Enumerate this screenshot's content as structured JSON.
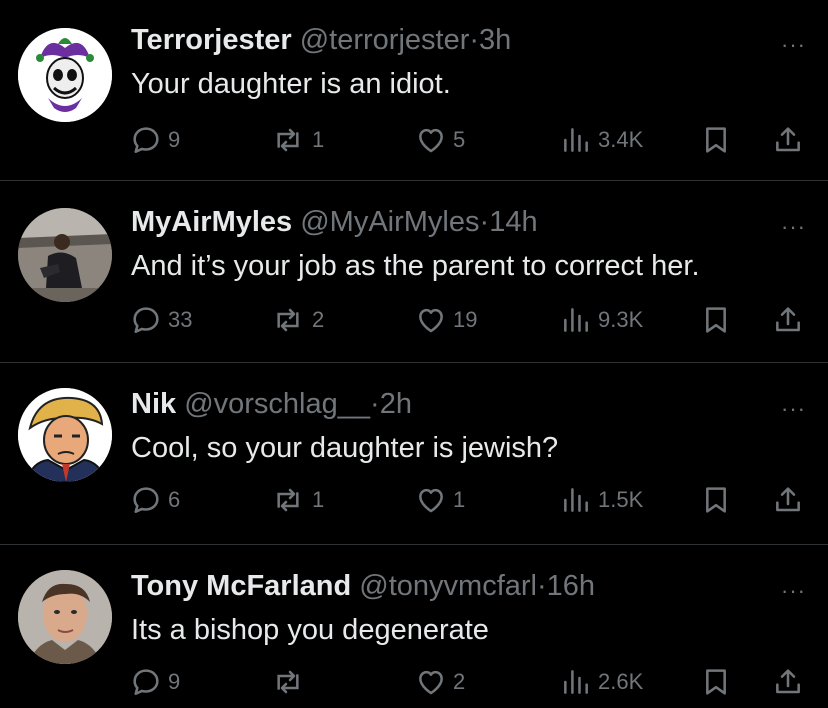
{
  "tweets": [
    {
      "name": "Terrorjester",
      "handle": "@terrorjester",
      "dot": "·",
      "time": "3h",
      "text": "Your daughter is an idiot.",
      "more": "···",
      "replies": "9",
      "reposts": "1",
      "likes": "5",
      "views": "3.4K"
    },
    {
      "name": "MyAirMyles",
      "handle": "@MyAirMyles",
      "dot": "·",
      "time": "14h",
      "text": "And it’s your job as the parent to correct her.",
      "more": "···",
      "replies": "33",
      "reposts": "2",
      "likes": "19",
      "views": "9.3K"
    },
    {
      "name": "Nik",
      "handle": "@vorschlag__",
      "dot": "·",
      "time": "2h",
      "text": "Cool, so your daughter is jewish?",
      "more": "···",
      "replies": "6",
      "reposts": "1",
      "likes": "1",
      "views": "1.5K"
    },
    {
      "name": "Tony McFarland",
      "handle": "@tonyvmcfarl",
      "dot": "·",
      "time": "16h",
      "text": "Its a bishop you degenerate",
      "more": "···",
      "replies": "9",
      "reposts": "",
      "likes": "2",
      "views": "2.6K"
    }
  ],
  "colors": {
    "background": "#000000",
    "text": "#e7e9ea",
    "muted": "#71767b",
    "divider": "#2f3336"
  },
  "icons": [
    "reply-icon",
    "repost-icon",
    "like-icon",
    "views-icon",
    "bookmark-icon",
    "share-icon",
    "more-icon"
  ]
}
